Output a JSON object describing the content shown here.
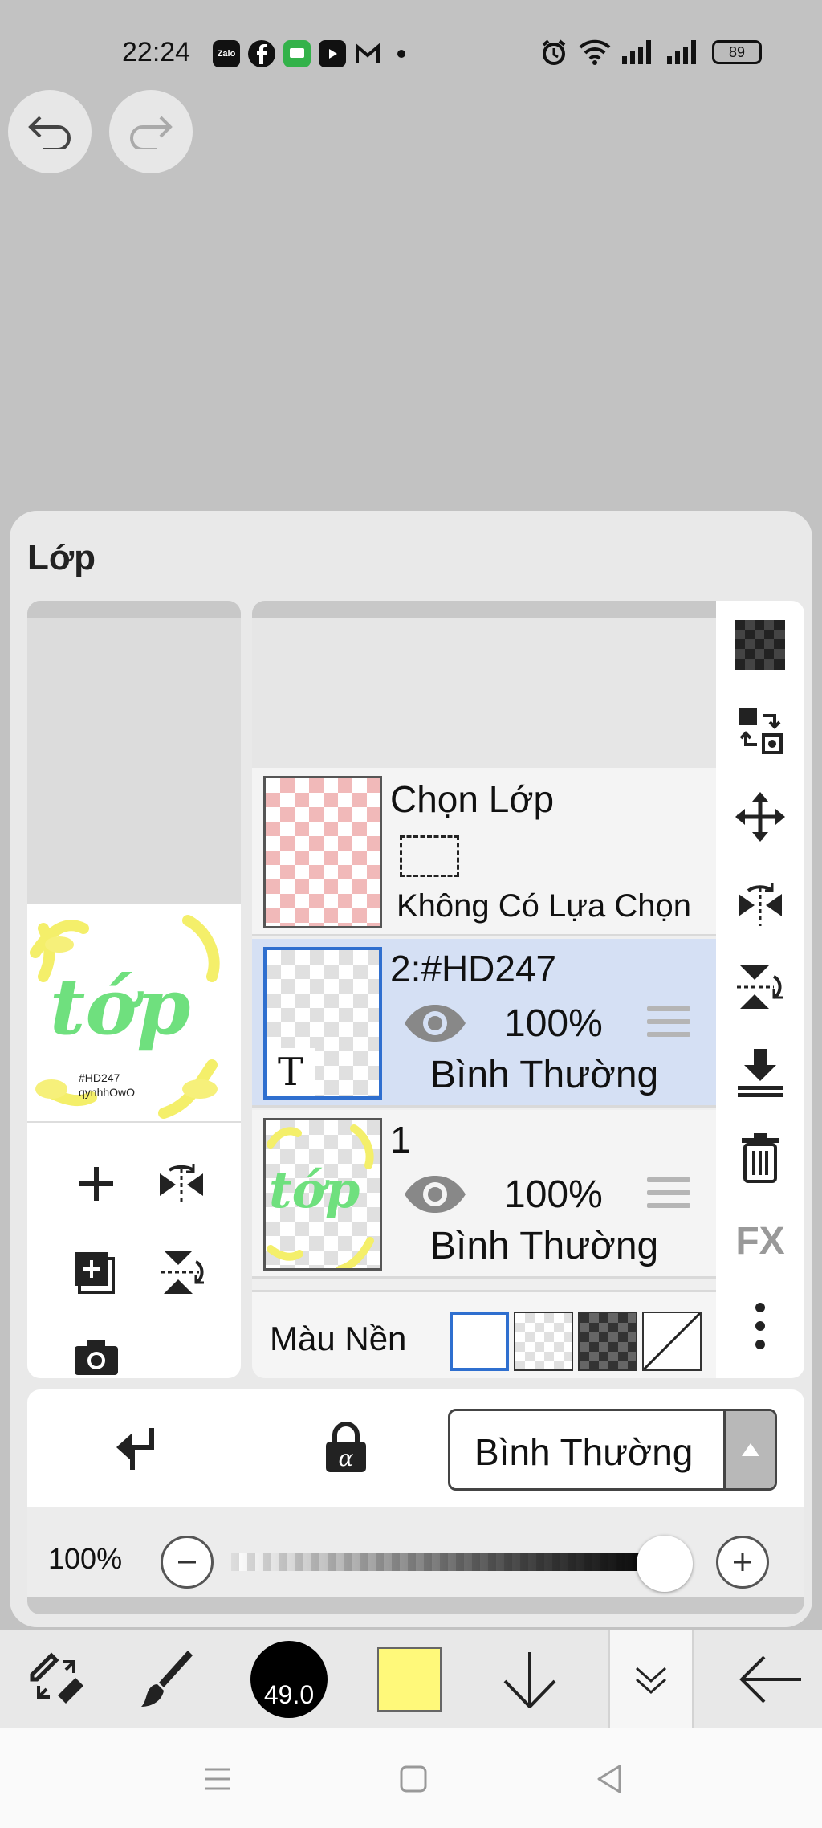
{
  "status": {
    "time": "22:24",
    "apps": [
      "Zalo",
      "facebook",
      "messages",
      "youtube",
      "gmail"
    ],
    "battery": "89"
  },
  "panel": {
    "title": "Lớp",
    "selection_layer": {
      "name": "Chọn Lớp",
      "status": "Không Có Lựa Chọn"
    },
    "layers": [
      {
        "name": "2:#HD247",
        "opacity": "100%",
        "blend": "Bình Thường",
        "selected": true
      },
      {
        "name": "1",
        "opacity": "100%",
        "blend": "Bình Thường",
        "selected": false
      }
    ],
    "preview": {
      "text": "tớp",
      "line1": "#HD247",
      "line2": "qynhhOwO"
    },
    "background": {
      "label": "Màu Nền"
    },
    "fx_label": "FX",
    "blend_mode": "Bình Thường",
    "opacity_label": "100%",
    "opacity_value": 1.0
  },
  "toolbar": {
    "brush_size": "49.0",
    "current_color": "#fff97a"
  },
  "icons": [
    "undo-icon",
    "redo-icon",
    "checkerboard-icon",
    "move-icon",
    "flip-icon",
    "merge-down-icon",
    "trash-icon",
    "more-icon",
    "camera-icon",
    "lock-alpha-icon"
  ]
}
